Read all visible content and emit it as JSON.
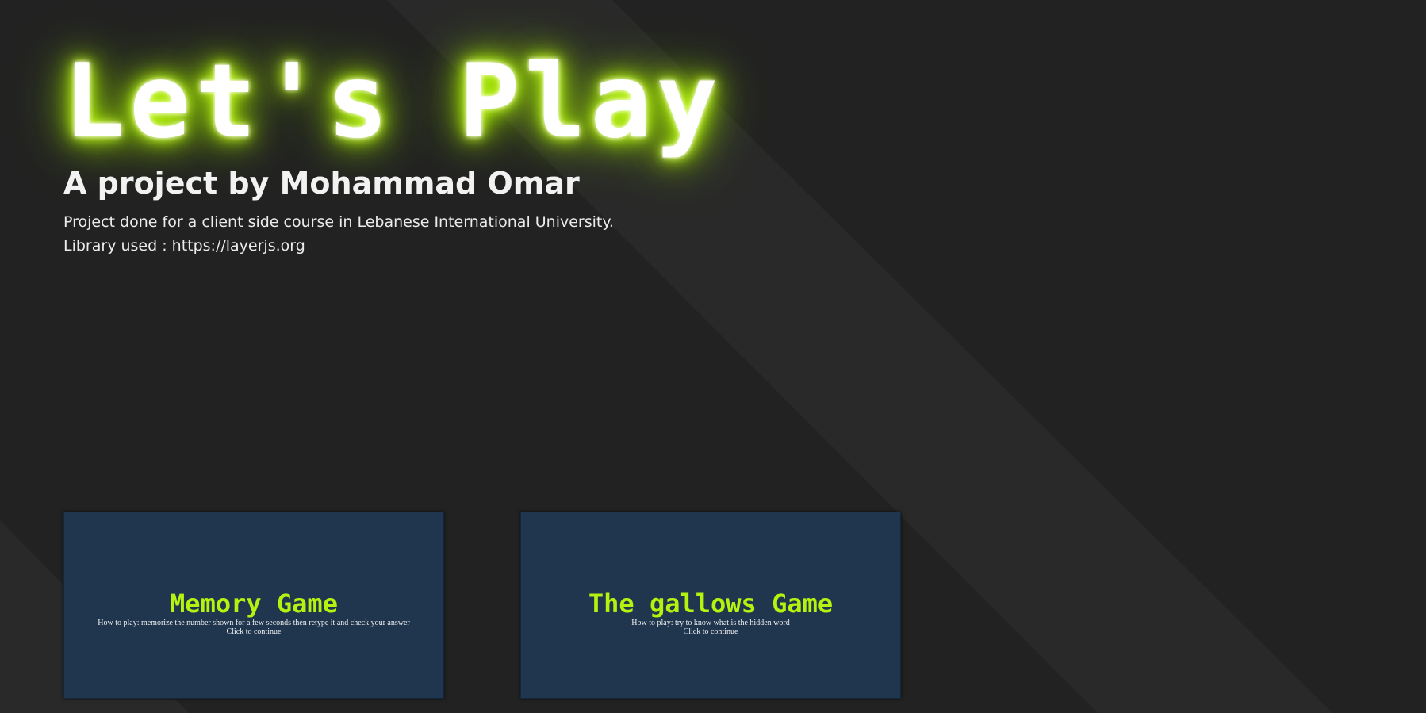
{
  "header": {
    "title": "Let's Play",
    "subtitle": "A project by Mohammad Omar",
    "description_line1": "Project done for a client side course in Lebanese International University.",
    "description_line2": "Library used : https://layerjs.org"
  },
  "games": [
    {
      "title": "Memory Game",
      "how_to_play": "How to play: memorize the number shown for a few seconds then retype it and check your answer",
      "cta": "Click to continue"
    },
    {
      "title": "The gallows Game",
      "how_to_play": "How to play: try to know what is the hidden word",
      "cta": "Click to continue"
    }
  ],
  "colors": {
    "background": "#222222",
    "accent_green": "#b5f20f",
    "card_background": "#20364f"
  }
}
